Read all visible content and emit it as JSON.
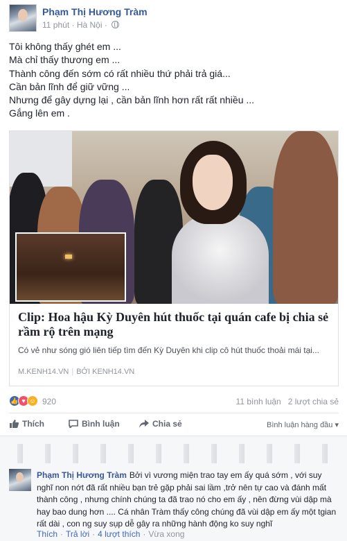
{
  "post": {
    "author": "Phạm Thị Hương Tràm",
    "time": "11 phút",
    "location": "Hà Nội",
    "privacy_icon": "globe-icon",
    "lines": [
      "Tôi không thấy ghét em ...",
      "Mà chỉ thấy thương em ...",
      "Thành công đến sớm có rất nhiều thứ phải trả giá...",
      "Cần bản lĩnh để giữ vững ...",
      "Nhưng để gây dựng lại , cần bản lĩnh hơn rất rất nhiều ...",
      "Gắng lên em ."
    ]
  },
  "link_preview": {
    "title": "Clip: Hoa hậu Kỳ Duyên hút thuốc tại quán cafe bị chia sẻ rầm rộ trên mạng",
    "description": "Có vẻ như sóng gió liên tiếp tìm đến Kỳ Duyên khi clip cô hút thuốc thoải mái tại...",
    "domain": "M.KENH14.VN",
    "by_label": "BỞI",
    "by_value": "KENH14.VN"
  },
  "reactions": {
    "count": "920",
    "comments": "11 bình luận",
    "shares": "2 lượt chia sẻ",
    "colors": {
      "like": "#4267b2",
      "love": "#f25268",
      "haha": "#f7b125"
    }
  },
  "actions": {
    "like": "Thích",
    "comment": "Bình luận",
    "share": "Chia sẻ",
    "sort": "Bình luận hàng đầu ▾"
  },
  "comment": {
    "author": "Phạm Thị Hương Tràm",
    "text": "Bởi vì vương miện trao tay em ấy quá sớm , với suy nghĩ non nớt đã rất nhiều bạn trẻ gặp phải sai lầm ,trở nên tự cao và đánh mất thành công , nhưng chính chúng ta đã trao nó cho em ấy , nên đừng vùi dập mà hay bao dung hơn .... Cá nhân Tràm thấy công chúng đã vùi dập em ấy một tgian rất dài , con ng suy sụp dễ gây ra những hành động ko suy nghĩ",
    "like": "Thích",
    "reply": "Trả lời",
    "likes": "4 lượt thích",
    "time": "Vừa xong"
  }
}
